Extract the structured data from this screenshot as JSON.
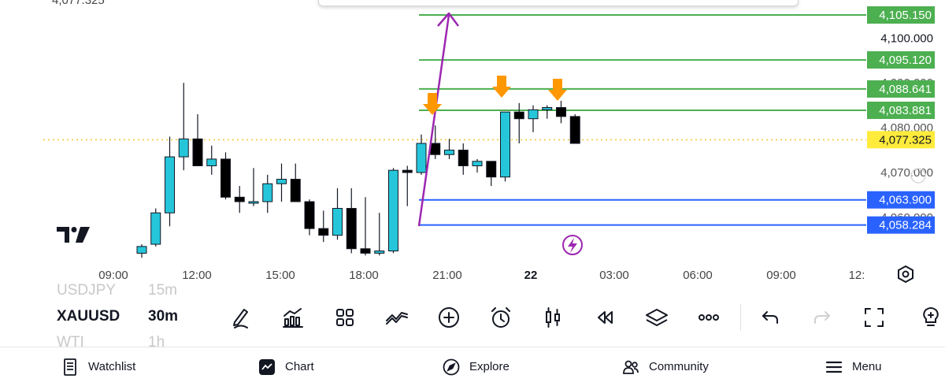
{
  "chart": {
    "top_partial_price": "4,077.325",
    "current_price": "4,077.325",
    "bolt_icon": "lightning-icon",
    "settings_icon": "hexagon-settings-icon",
    "accent_colors": {
      "bull": "#26c6da",
      "bear": "#000000",
      "resistance": "#4caf50",
      "support": "#2962ff",
      "current": "#ffeb3b",
      "trend": "#9c27b0",
      "arrow": "#ff9800"
    },
    "price_scale": [
      "4,100.000",
      "4,090.000",
      "4,080.000",
      "4,070.000",
      "4,060.000"
    ],
    "time_labels": [
      "09:00",
      "12:00",
      "15:00",
      "18:00",
      "21:00",
      "22",
      "03:00",
      "06:00",
      "09:00",
      "12:"
    ],
    "levels": [
      {
        "label": "4,105.150",
        "price": 4105.15,
        "kind": "resistance"
      },
      {
        "label": "4,095.120",
        "price": 4095.12,
        "kind": "resistance"
      },
      {
        "label": "4,088.641",
        "price": 4088.641,
        "kind": "resistance"
      },
      {
        "label": "4,083.881",
        "price": 4083.881,
        "kind": "resistance"
      },
      {
        "label": "4,063.900",
        "price": 4063.9,
        "kind": "support"
      },
      {
        "label": "4,058.284",
        "price": 4058.284,
        "kind": "support"
      }
    ],
    "candles": [
      {
        "o": 4052.0,
        "h": 4054.0,
        "l": 4051.0,
        "c": 4053.5
      },
      {
        "o": 4054.0,
        "h": 4062.0,
        "l": 4053.5,
        "c": 4061.0
      },
      {
        "o": 4061.0,
        "h": 4078.0,
        "l": 4058.0,
        "c": 4073.5
      },
      {
        "o": 4073.5,
        "h": 4090.0,
        "l": 4070.5,
        "c": 4077.5
      },
      {
        "o": 4077.5,
        "h": 4083.0,
        "l": 4071.5,
        "c": 4071.5
      },
      {
        "o": 4071.5,
        "h": 4076.0,
        "l": 4069.5,
        "c": 4073.0
      },
      {
        "o": 4073.0,
        "h": 4074.5,
        "l": 4064.0,
        "c": 4064.5
      },
      {
        "o": 4064.5,
        "h": 4067.0,
        "l": 4061.0,
        "c": 4063.5
      },
      {
        "o": 4063.5,
        "h": 4071.0,
        "l": 4062.5,
        "c": 4063.5
      },
      {
        "o": 4063.5,
        "h": 4069.5,
        "l": 4061.0,
        "c": 4067.5
      },
      {
        "o": 4067.5,
        "h": 4072.0,
        "l": 4063.5,
        "c": 4068.5
      },
      {
        "o": 4068.5,
        "h": 4072.0,
        "l": 4063.5,
        "c": 4063.5
      },
      {
        "o": 4063.5,
        "h": 4064.0,
        "l": 4056.0,
        "c": 4057.5
      },
      {
        "o": 4057.5,
        "h": 4061.5,
        "l": 4054.5,
        "c": 4056.0
      },
      {
        "o": 4056.0,
        "h": 4066.5,
        "l": 4055.0,
        "c": 4062.0
      },
      {
        "o": 4062.0,
        "h": 4066.5,
        "l": 4052.0,
        "c": 4053.0
      },
      {
        "o": 4053.0,
        "h": 4064.5,
        "l": 4051.5,
        "c": 4052.0
      },
      {
        "o": 4052.0,
        "h": 4061.0,
        "l": 4051.5,
        "c": 4052.5
      },
      {
        "o": 4052.5,
        "h": 4071.0,
        "l": 4052.0,
        "c": 4070.5
      },
      {
        "o": 4070.5,
        "h": 4071.5,
        "l": 4062.5,
        "c": 4070.0
      },
      {
        "o": 4070.0,
        "h": 4078.5,
        "l": 4069.5,
        "c": 4076.5
      },
      {
        "o": 4076.5,
        "h": 4080.5,
        "l": 4073.0,
        "c": 4074.0
      },
      {
        "o": 4074.0,
        "h": 4077.5,
        "l": 4073.0,
        "c": 4075.0
      },
      {
        "o": 4075.0,
        "h": 4076.5,
        "l": 4069.5,
        "c": 4071.5
      },
      {
        "o": 4071.5,
        "h": 4073.0,
        "l": 4070.0,
        "c": 4072.5
      },
      {
        "o": 4072.5,
        "h": 4072.5,
        "l": 4067.0,
        "c": 4069.0
      },
      {
        "o": 4069.0,
        "h": 4083.5,
        "l": 4068.0,
        "c": 4083.5
      },
      {
        "o": 4083.5,
        "h": 4085.5,
        "l": 4076.5,
        "c": 4082.0
      },
      {
        "o": 4082.0,
        "h": 4085.0,
        "l": 4079.0,
        "c": 4084.0
      },
      {
        "o": 4084.0,
        "h": 4085.0,
        "l": 4082.0,
        "c": 4084.5
      },
      {
        "o": 4084.5,
        "h": 4086.0,
        "l": 4081.0,
        "c": 4082.5
      },
      {
        "o": 4082.5,
        "h": 4083.0,
        "l": 4076.5,
        "c": 4076.5
      }
    ]
  },
  "symbols": {
    "prev": {
      "symbol": "USDJPY",
      "tf": "15m"
    },
    "active": {
      "symbol": "XAUUSD",
      "tf": "30m"
    },
    "next": {
      "symbol": "WTI",
      "tf": "1h"
    }
  },
  "toolbar": [
    {
      "name": "drawing-tools-icon"
    },
    {
      "name": "indicators-icon"
    },
    {
      "name": "layouts-icon"
    },
    {
      "name": "compare-icon"
    },
    {
      "name": "add-symbol-icon"
    },
    {
      "name": "alert-icon"
    },
    {
      "name": "candle-type-icon"
    },
    {
      "name": "replay-icon"
    },
    {
      "name": "layers-icon"
    },
    {
      "name": "more-icon"
    },
    {
      "name": "undo-icon"
    },
    {
      "name": "redo-icon"
    },
    {
      "name": "fullscreen-icon"
    },
    {
      "name": "ideas-icon"
    }
  ],
  "nav": {
    "watchlist": "Watchlist",
    "chart": "Chart",
    "explore": "Explore",
    "community": "Community",
    "menu": "Menu"
  }
}
